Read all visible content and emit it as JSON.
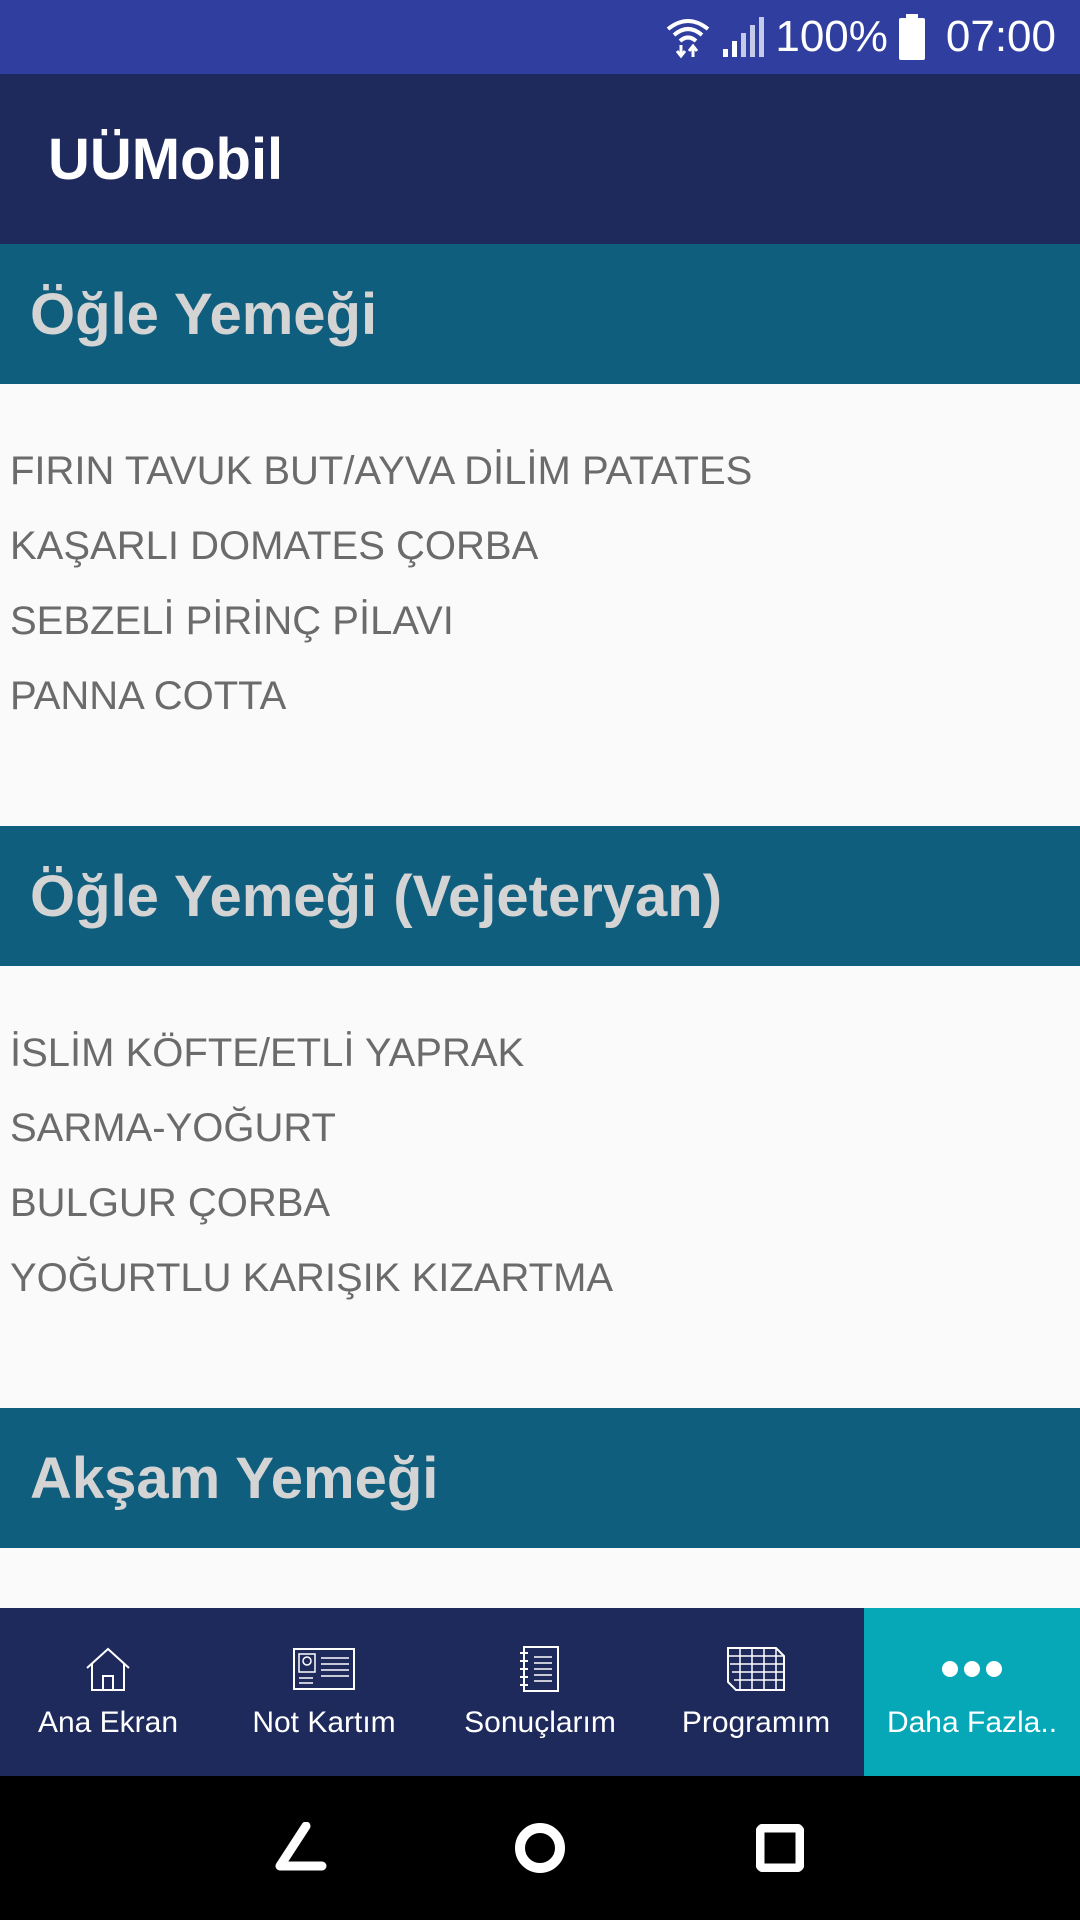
{
  "status_bar": {
    "battery_percent": "100%",
    "time": "07:00",
    "icons": [
      "wifi-icon",
      "signal-icon",
      "battery-icon"
    ]
  },
  "app_bar": {
    "title": "UÜMobil"
  },
  "sections": [
    {
      "title": "Öğle Yemeği",
      "items": [
        "FIRIN TAVUK BUT/AYVA DİLİM PATATES",
        "KAŞARLI DOMATES ÇORBA",
        "SEBZELİ PİRİNÇ PİLAVI",
        "PANNA COTTA"
      ]
    },
    {
      "title": "Öğle Yemeği (Vejeteryan)",
      "items": [
        "İSLİM KÖFTE/ETLİ YAPRAK",
        "SARMA-YOĞURT",
        "BULGUR ÇORBA",
        "YOĞURTLU KARIŞIK KIZARTMA"
      ]
    },
    {
      "title": "Akşam Yemeği",
      "items": []
    }
  ],
  "bottom_nav": {
    "items": [
      {
        "label": "Ana Ekran",
        "icon": "home-icon"
      },
      {
        "label": "Not Kartım",
        "icon": "id-card-icon"
      },
      {
        "label": "Sonuçlarım",
        "icon": "notebook-icon"
      },
      {
        "label": "Programım",
        "icon": "schedule-grid-icon"
      },
      {
        "label": "Daha Fazla..",
        "icon": "more-dots-icon",
        "active": true
      }
    ]
  },
  "system_nav": {
    "icons": [
      "back-icon",
      "home-circle-icon",
      "recents-icon"
    ]
  },
  "colors": {
    "status_bar": "#303f9f",
    "app_bar": "#1f2a5c",
    "section_header": "#105e7e",
    "active_tab": "#06a8b8"
  }
}
